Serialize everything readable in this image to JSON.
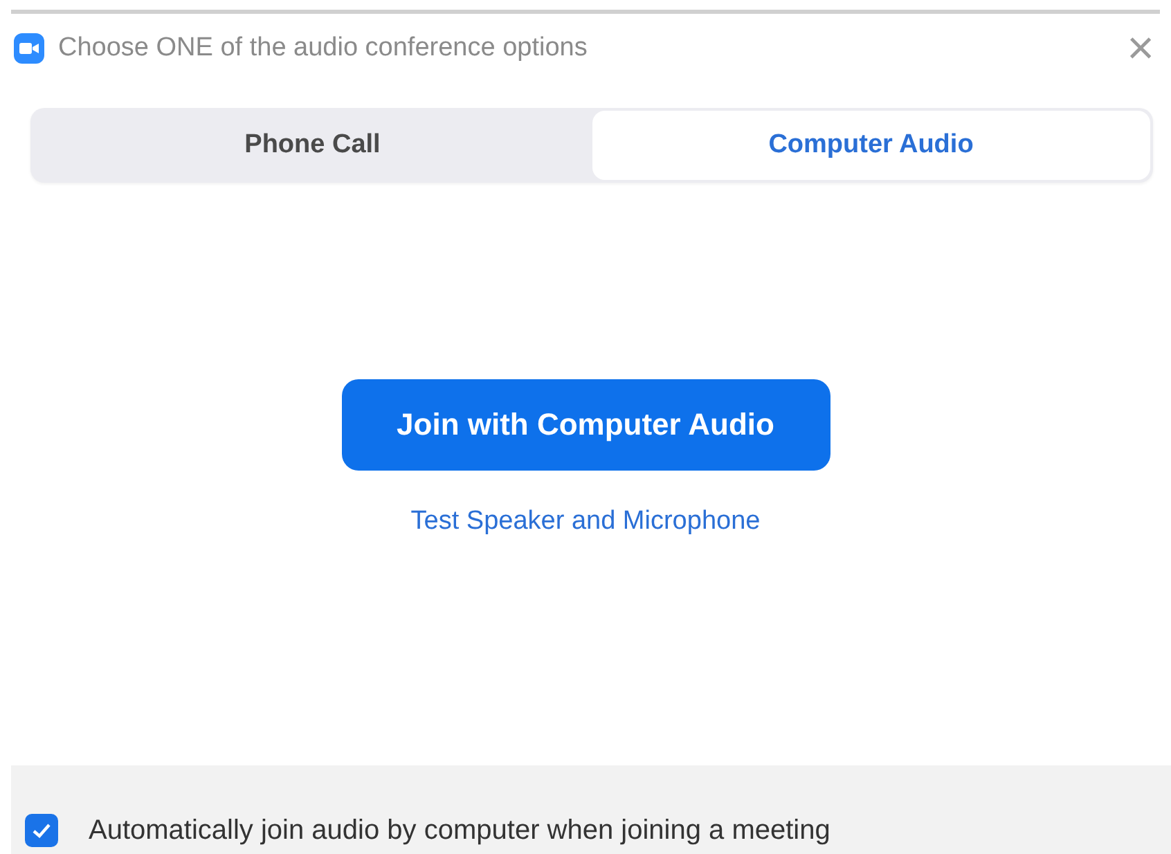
{
  "window": {
    "title": "Choose ONE of the audio conference options",
    "close": "×"
  },
  "tabs": [
    {
      "label": "Phone Call",
      "selected": false
    },
    {
      "label": "Computer Audio",
      "selected": true
    }
  ],
  "join_button": "Join with Computer Audio",
  "test_link": "Test Speaker and Microphone",
  "auto_join": {
    "label": "Automatically join audio by computer when joining a meeting",
    "checked": true
  }
}
